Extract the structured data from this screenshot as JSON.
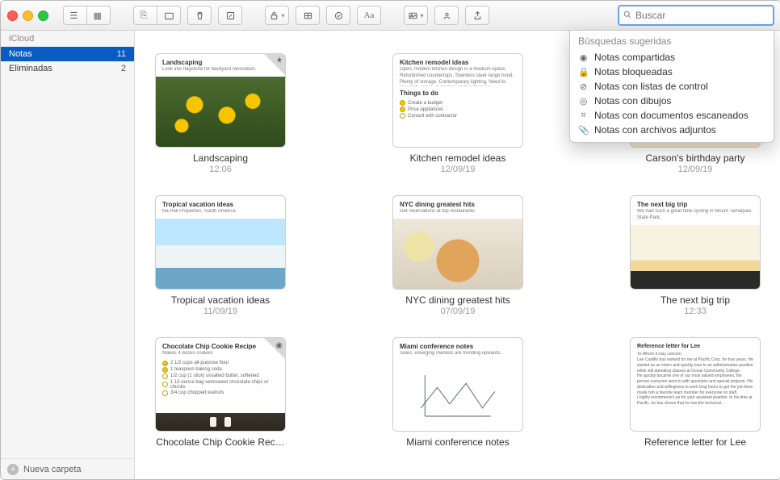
{
  "search": {
    "placeholder": "Buscar"
  },
  "sidebar": {
    "account": "iCloud",
    "rows": [
      {
        "label": "Notas",
        "count": "11",
        "selected": true
      },
      {
        "label": "Eliminadas",
        "count": "2",
        "selected": false
      }
    ],
    "new_folder": "Nueva carpeta"
  },
  "suggestions": {
    "heading": "Búsquedas sugeridas",
    "items": [
      {
        "glyph": "◉",
        "label": "Notas compartidas"
      },
      {
        "glyph": "🔒",
        "label": "Notas bloqueadas"
      },
      {
        "glyph": "⊘",
        "label": "Notas con listas de control"
      },
      {
        "glyph": "◎",
        "label": "Notas con dibujos"
      },
      {
        "glyph": "⌗",
        "label": "Notas con documentos escaneados"
      },
      {
        "glyph": "📎",
        "label": "Notas con archivos adjuntos"
      }
    ]
  },
  "notes": [
    {
      "title": "Landscaping",
      "date": "12:06",
      "pinned": true,
      "preview_title": "Landscaping",
      "preview_sub": "Look into flagstone for backyard renovation.",
      "art": "flowers"
    },
    {
      "title": "Kitchen remodel ideas",
      "date": "12/09/19",
      "preview_title": "Kitchen remodel ideas",
      "preview_sub": "Open, modern kitchen design in a medium space. Refurbished countertops. Stainless steel range hood. Plenty of storage. Contemporary lighting. Need to research colors, materials, and appliances.",
      "section": "Things to do",
      "checks": [
        {
          "done": true,
          "text": "Create a budget"
        },
        {
          "done": true,
          "text": "Price appliances"
        },
        {
          "done": false,
          "text": "Consult with contractor"
        }
      ]
    },
    {
      "title": "Carson's birthday party",
      "date": "12/09/19"
    },
    {
      "title": "Tropical vacation ideas",
      "date": "11/09/19",
      "preview_title": "Tropical vacation ideas",
      "preview_sub": "Na Pali Properties, South America",
      "art": "santorini"
    },
    {
      "title": "NYC dining greatest hits",
      "date": "07/09/19",
      "preview_title": "NYC dining greatest hits",
      "preview_sub": "Get reservations at top restaurants.",
      "art": "burger"
    },
    {
      "title": "The next big trip",
      "date": "12:33",
      "preview_title": "The next big trip",
      "preview_sub": "We had such a great time cycling in Mount Tamalpais State Park:",
      "art": "sunset"
    },
    {
      "title": "Chocolate Chip Cookie Rec…",
      "date": "",
      "shared": true,
      "preview_title": "Chocolate Chip Cookie Recipe",
      "preview_sub": "Makes 4 dozen cookies",
      "checks": [
        {
          "done": true,
          "text": "2 1/2 cups all-purpose flour"
        },
        {
          "done": true,
          "text": "1 teaspoon baking soda"
        },
        {
          "done": false,
          "text": "1/2 cup (1 stick) unsalted butter, softened"
        },
        {
          "done": false,
          "text": "1 12-ounce bag semisweet chocolate chips or chunks"
        },
        {
          "done": false,
          "text": "3/4 cup chopped walnuts"
        }
      ]
    },
    {
      "title": "Miami conference notes",
      "date": "",
      "preview_title": "Miami conference notes",
      "preview_sub": "Sales: emerging markets are trending upwards.",
      "art": "miami"
    },
    {
      "title": "Reference letter for Lee",
      "date": "",
      "preview_title": "Reference letter for Lee",
      "body": [
        "To Whom it may concern,",
        "Lee Castillo has worked for me at Pacific Corp. for four years. He started as an intern and quickly rose to an administrative position while still attending classes at Ocean Community College.",
        "He quickly became one of our most valued employees, the person everyone went to with questions and special projects. His dedication and willingness to work long hours to get the job done made him a favorite team member for everyone on staff.",
        "I highly recommend Lee for your assistant position. In his time at Pacific, he has shown that he has the technical…"
      ]
    }
  ]
}
